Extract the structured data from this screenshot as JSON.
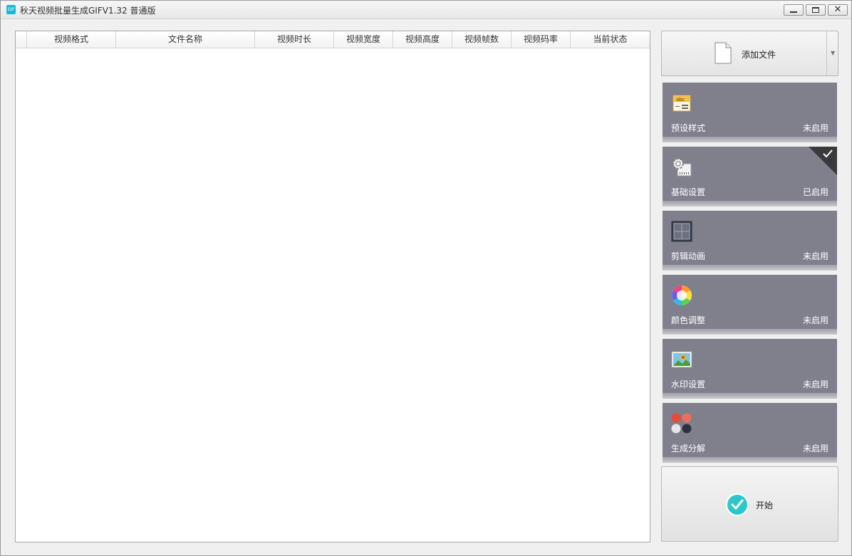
{
  "titlebar": {
    "app_icon_text": "GIF",
    "title": "秋天视频批量生成GIFV1.32 普通版"
  },
  "table": {
    "columns": [
      "视频格式",
      "文件名称",
      "视频时长",
      "视频宽度",
      "视频高度",
      "视频帧数",
      "视频码率",
      "当前状态"
    ],
    "rows": []
  },
  "add_file": {
    "label": "添加文件",
    "icon": "file-icon"
  },
  "cards": [
    {
      "name": "预设样式",
      "status": "未启用",
      "icon": "abc-preset-icon",
      "active": false
    },
    {
      "name": "基础设置",
      "status": "已启用",
      "icon": "gear-settings-icon",
      "active": true
    },
    {
      "name": "剪辑动画",
      "status": "未启用",
      "icon": "crop-grid-icon",
      "active": false
    },
    {
      "name": "颜色调整",
      "status": "未启用",
      "icon": "color-wheel-icon",
      "active": false
    },
    {
      "name": "水印设置",
      "status": "未启用",
      "icon": "image-watermark-icon",
      "active": false
    },
    {
      "name": "生成分解",
      "status": "未启用",
      "icon": "color-dots-icon",
      "active": false
    }
  ],
  "start": {
    "label": "开始",
    "icon": "check-circle-icon"
  },
  "colors": {
    "card_bg": "#7f808c",
    "accent_teal": "#2cc7c9"
  }
}
